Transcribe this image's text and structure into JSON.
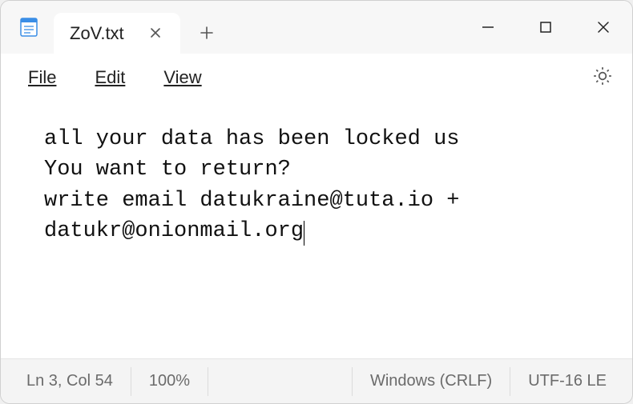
{
  "tab": {
    "title": "ZoV.txt"
  },
  "menu": {
    "file": "File",
    "edit": "Edit",
    "view": "View"
  },
  "content": "all your data has been locked us\nYou want to return?\nwrite email datukraine@tuta.io + datukr@onionmail.org",
  "status": {
    "position": "Ln 3, Col 54",
    "zoom": "100%",
    "line_ending": "Windows (CRLF)",
    "encoding": "UTF-16 LE"
  }
}
